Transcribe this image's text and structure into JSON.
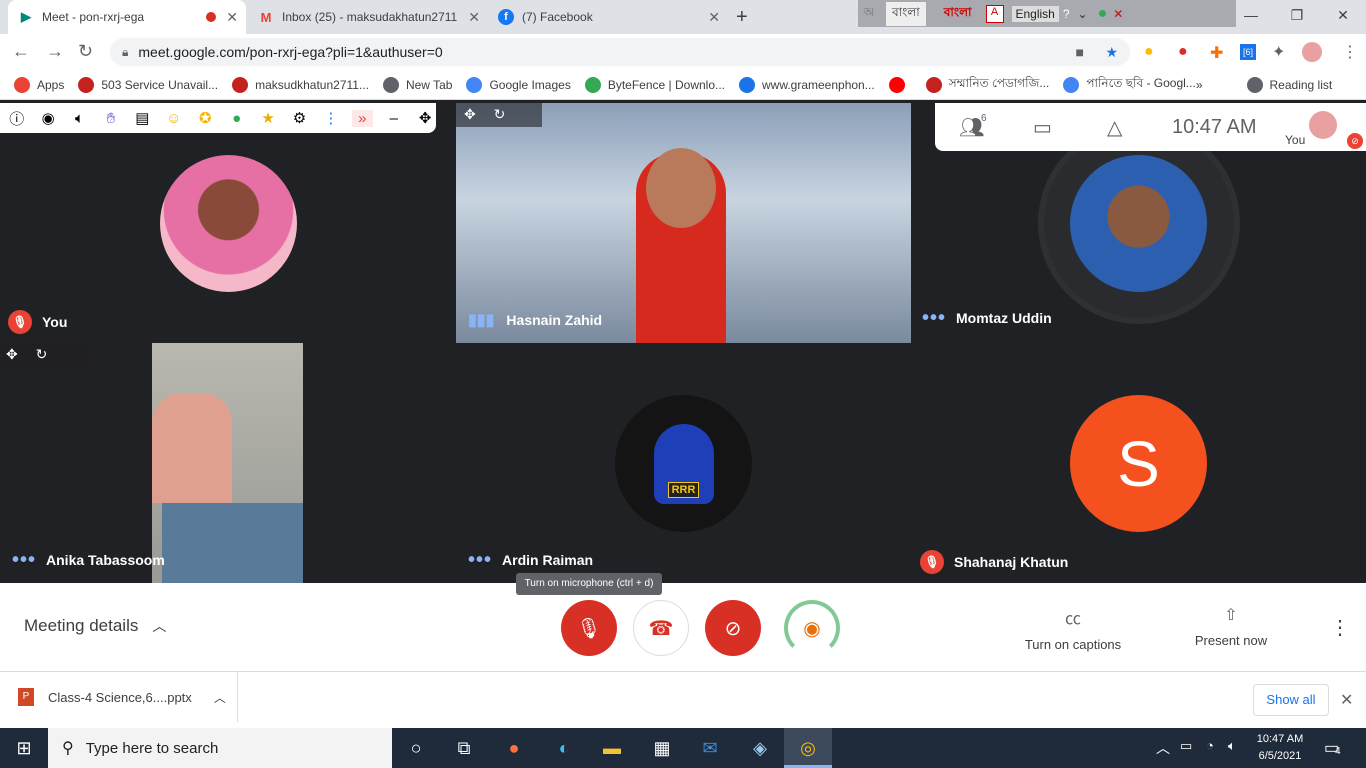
{
  "tabs": [
    {
      "title": "Meet - pon-rxrj-ega",
      "icon": "google-meet-icon"
    },
    {
      "title": "Inbox (25) - maksudakhatun2711",
      "icon": "gmail-icon"
    },
    {
      "title": "(7) Facebook",
      "icon": "facebook-icon"
    }
  ],
  "ime": {
    "bangla": "বাংলা",
    "bijoy": "বাংলা",
    "english": "English"
  },
  "url": "meet.google.com/pon-rxrj-ega?pli=1&authuser=0",
  "bookmarks": [
    {
      "label": "Apps",
      "color": "#ea4335"
    },
    {
      "label": "503 Service Unavail...",
      "color": "#c5221f"
    },
    {
      "label": "maksudkhatun2711...",
      "color": "#c5221f"
    },
    {
      "label": "New Tab",
      "color": "#5f6368"
    },
    {
      "label": "Google Images",
      "color": "#4285f4"
    },
    {
      "label": "ByteFence | Downlo...",
      "color": "#34a853"
    },
    {
      "label": "www.grameenphon...",
      "color": "#1a73e8"
    },
    {
      "label": "",
      "color": "#ff0000"
    },
    {
      "label": "সম্মানিত পেডাগজি...",
      "color": "#c5221f"
    },
    {
      "label": "পানিতে ছবি - Googl...",
      "color": "#4285f4"
    },
    {
      "label": "Reading list",
      "color": "#5f6368"
    }
  ],
  "participants": {
    "you": "You",
    "hasnain": "Hasnain Zahid",
    "momtaz": "Momtaz Uddin",
    "anika": "Anika Tabassoom",
    "ardin": "Ardin Raiman",
    "shahanaj": "Shahanaj Khatun",
    "shahanaj_initial": "S",
    "ardin_logo": "RRR"
  },
  "top_panel": {
    "time": "10:47  AM",
    "self_label": "You"
  },
  "bottom_bar": {
    "meeting_details": "Meeting details",
    "captions": "Turn on captions",
    "present": "Present now",
    "tooltip": "Turn on microphone (ctrl + d)"
  },
  "downloads": {
    "file": "Class-4 Science,6....pptx",
    "show_all": "Show all"
  },
  "taskbar": {
    "search_placeholder": "Type here to search",
    "time": "10:47 AM",
    "date": "6/5/2021",
    "notifications": "4"
  }
}
